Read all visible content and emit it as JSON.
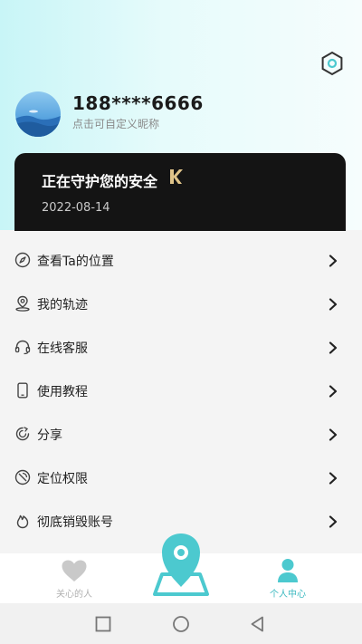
{
  "header": {
    "phone": "188****6666",
    "nickname_hint": "点击可自定义昵称"
  },
  "guard_card": {
    "title": "正在守护您的安全",
    "date": "2022-08-14"
  },
  "menu": {
    "items": [
      {
        "label": "查看Ta的位置",
        "icon": "compass-icon"
      },
      {
        "label": "我的轨迹",
        "icon": "location-pin-icon"
      },
      {
        "label": "在线客服",
        "icon": "headset-icon"
      },
      {
        "label": "使用教程",
        "icon": "phone-icon"
      },
      {
        "label": "分享",
        "icon": "share-icon"
      },
      {
        "label": "定位权限",
        "icon": "satellite-icon"
      },
      {
        "label": "彻底销毁账号",
        "icon": "flame-icon"
      }
    ]
  },
  "tabbar": {
    "tabs": [
      {
        "label": "关心的人",
        "icon": "heart-icon"
      },
      {
        "label": "个人中心",
        "icon": "person-icon"
      }
    ]
  },
  "colors": {
    "accent": "#4cc9cf",
    "card_bg": "#141414",
    "header_gradient_start": "#c8f5f7"
  }
}
